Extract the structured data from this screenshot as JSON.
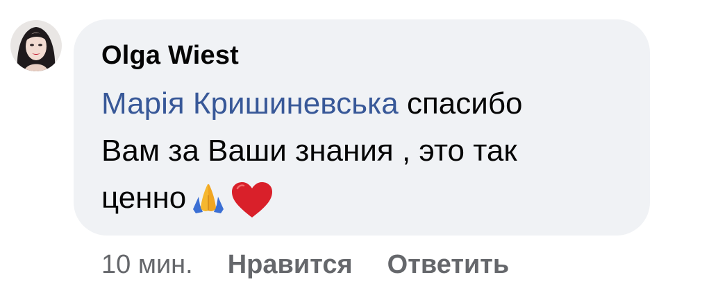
{
  "comment": {
    "author": "Olga Wiest",
    "mention": "Марія Кришиневська",
    "line1_after_mention": "спасибо",
    "line2": "Вам за Ваши знания , это так",
    "line3": "ценно",
    "emojis": [
      "folded-hands-emoji",
      "red-heart-emoji"
    ]
  },
  "actions": {
    "timestamp": "10 мин.",
    "like_label": "Нравится",
    "reply_label": "Ответить"
  },
  "colors": {
    "bubble": "#f0f2f5",
    "text": "#050505",
    "mention": "#385898",
    "meta": "#65676b"
  }
}
